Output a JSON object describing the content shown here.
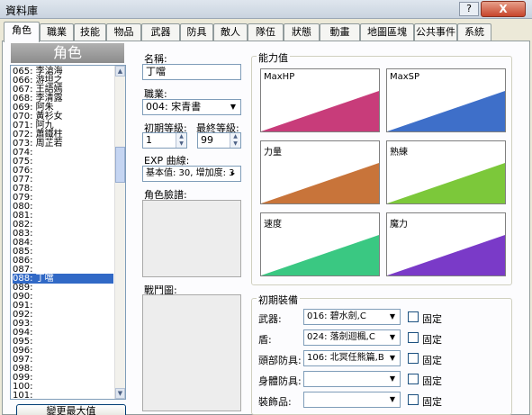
{
  "window": {
    "title": "資料庫",
    "help_label": "?",
    "close_label": "X"
  },
  "tabs": [
    "角色",
    "職業",
    "技能",
    "物品",
    "武器",
    "防具",
    "敵人",
    "隊伍",
    "狀態",
    "動畫",
    "地圖區塊",
    "公共事件",
    "系統"
  ],
  "active_tab": 0,
  "character_list": {
    "header": "角色",
    "items": [
      "065: 李滄海",
      "066: 游坦之",
      "067: 王語嫣",
      "068: 李清露",
      "069: 阿朱",
      "070: 黃衫女",
      "071: 阿九",
      "072: 蕭鐵柱",
      "073: 周芷若",
      "074:",
      "075:",
      "076:",
      "077:",
      "078:",
      "079:",
      "080:",
      "081:",
      "082:",
      "083:",
      "084:",
      "085:",
      "086:",
      "087:",
      "088: 丁噹",
      "089:",
      "090:",
      "091:",
      "092:",
      "093:",
      "094:",
      "095:",
      "096:",
      "097:",
      "098:",
      "099:",
      "100:",
      "101:"
    ],
    "selected_index": 23,
    "change_max_button": "變更最大值"
  },
  "form": {
    "name_label": "名稱:",
    "name_value": "丁噹",
    "class_label": "職業:",
    "class_value": "004: 宋青書",
    "initial_level_label": "初期等級:",
    "initial_level_value": "1",
    "final_level_label": "最終等級:",
    "final_level_value": "99",
    "exp_label": "EXP 曲線:",
    "exp_value": "基本值: 30, 增加度: 3",
    "face_label": "角色臉譜:",
    "battler_label": "戰鬥圖:"
  },
  "stats": {
    "title": "能力值",
    "items": [
      {
        "label": "MaxHP",
        "color": "#c83c7a"
      },
      {
        "label": "MaxSP",
        "color": "#3e6fc9"
      },
      {
        "label": "力量",
        "color": "#c8743a"
      },
      {
        "label": "熟練",
        "color": "#7cc83a"
      },
      {
        "label": "速度",
        "color": "#3ac882"
      },
      {
        "label": "魔力",
        "color": "#7a3ac8"
      }
    ]
  },
  "equipment": {
    "title": "初期裝備",
    "fixed_label": "固定",
    "rows": [
      {
        "label": "武器:",
        "value": "016: 碧水劍,C"
      },
      {
        "label": "盾:",
        "value": "024: 落劍迴楓,C"
      },
      {
        "label": "頭部防具:",
        "value": "106: 北冥任熊篇,B"
      },
      {
        "label": "身體防具:",
        "value": ""
      },
      {
        "label": "裝飾品:",
        "value": ""
      }
    ]
  }
}
